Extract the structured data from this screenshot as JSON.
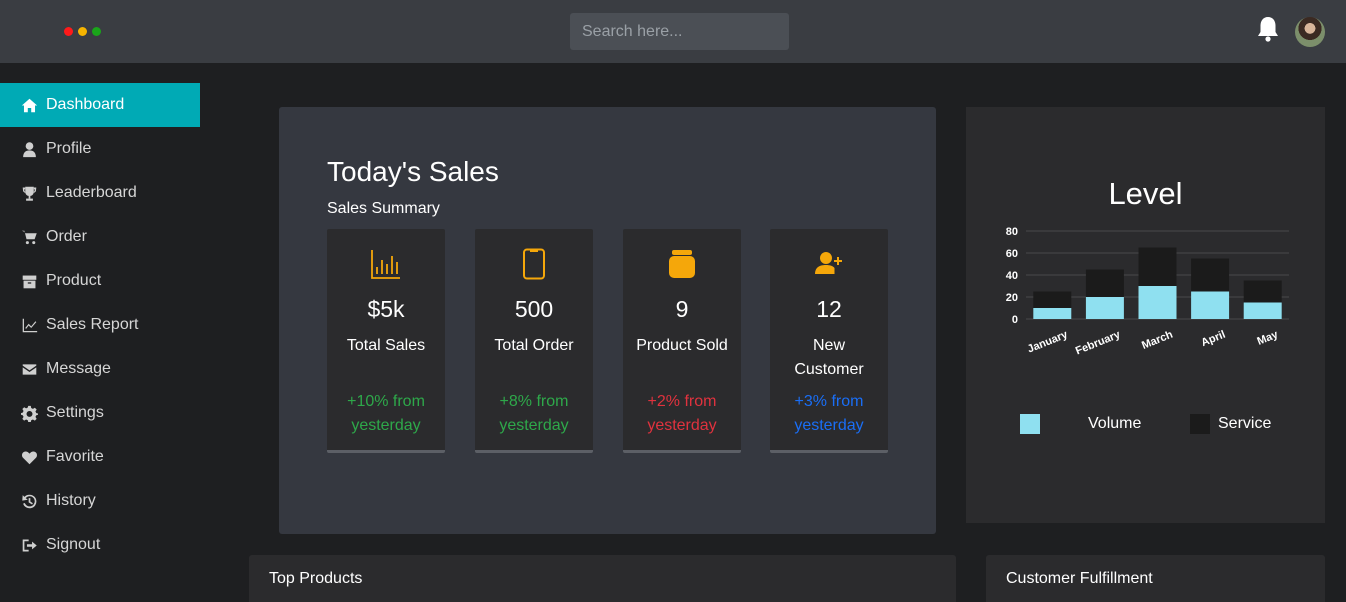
{
  "topbar": {
    "window_dots": [
      {
        "name": "red",
        "color": "#ff1a1a"
      },
      {
        "name": "yellow",
        "color": "#f5b400"
      },
      {
        "name": "green",
        "color": "#1aa51a"
      }
    ],
    "search_placeholder": "Search here...",
    "bell_icon": "bell-icon",
    "avatar": "user-avatar"
  },
  "sidebar": {
    "accent_color": "#00aab5",
    "items": [
      {
        "label": "Dashboard",
        "icon": "home-icon",
        "active": true
      },
      {
        "label": "Profile",
        "icon": "user-icon"
      },
      {
        "label": "Leaderboard",
        "icon": "trophy-icon"
      },
      {
        "label": "Order",
        "icon": "cart-icon"
      },
      {
        "label": "Product",
        "icon": "box-icon"
      },
      {
        "label": "Sales Report",
        "icon": "line-chart-icon"
      },
      {
        "label": "Message",
        "icon": "envelope-icon"
      },
      {
        "label": "Settings",
        "icon": "gear-icon"
      },
      {
        "label": "Favorite",
        "icon": "heart-icon"
      },
      {
        "label": "History",
        "icon": "history-icon"
      },
      {
        "label": "Signout",
        "icon": "signout-icon"
      }
    ]
  },
  "sales": {
    "title": "Today's Sales",
    "subtitle": "Sales Summary",
    "icon_color": "#f5a70a",
    "stats": [
      {
        "icon": "bar-chart-icon",
        "value": "$5k",
        "label": "Total Sales",
        "change": "+10% from yesterday",
        "change_color": "#2ea84a"
      },
      {
        "icon": "phone-icon",
        "value": "500",
        "label": "Total Order",
        "change": "+8% from yesterday",
        "change_color": "#2ea84a"
      },
      {
        "icon": "product-icon",
        "value": "9",
        "label": "Product Sold",
        "change": "+2% from yesterday",
        "change_color": "#e0323e"
      },
      {
        "icon": "add-user-icon",
        "value": "12",
        "label": "New Customer",
        "change": "+3% from yesterday",
        "change_color": "#1a6ef5"
      }
    ]
  },
  "level": {
    "title": "Level",
    "legend": [
      {
        "label": "Volume",
        "color": "#8fe0f0"
      },
      {
        "label": "Service",
        "color": "#1b1b1b"
      }
    ]
  },
  "chart_data": {
    "type": "bar",
    "stacked": false,
    "categories": [
      "January",
      "February",
      "March",
      "April",
      "May"
    ],
    "series": [
      {
        "name": "Volume",
        "values": [
          10,
          20,
          30,
          25,
          15
        ],
        "color": "#8fe0f0"
      },
      {
        "name": "Service",
        "values": [
          25,
          45,
          65,
          55,
          35
        ],
        "color": "#1b1b1b"
      }
    ],
    "yticks": [
      "0",
      "20",
      "40",
      "60",
      "80"
    ],
    "ylim": [
      0,
      80
    ],
    "grid": true,
    "legend_position": "bottom"
  },
  "panels": {
    "top_products": "Top Products",
    "customer_fulfillment": "Customer Fulfillment"
  }
}
